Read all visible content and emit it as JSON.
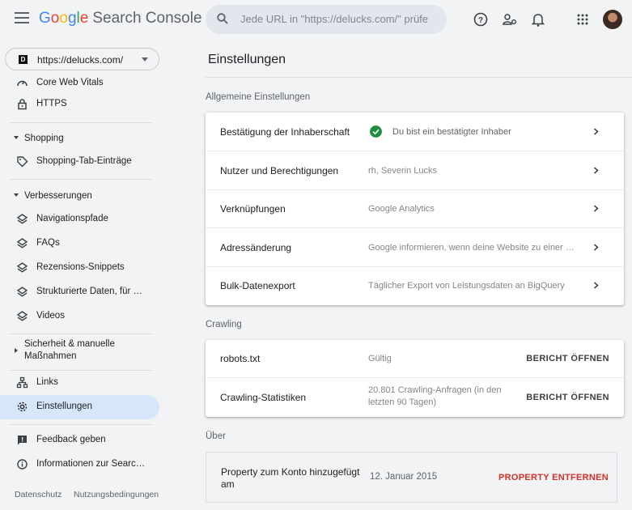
{
  "header": {
    "brand_google": "Google",
    "brand_product": "Search Console",
    "search_placeholder": "Jede URL in \"https://delucks.com/\" prüfe"
  },
  "sidebar": {
    "property_url": "https://delucks.com/",
    "property_favicon": "D",
    "items_top": [
      {
        "label": "Core Web Vitals",
        "icon": "gauge-icon"
      },
      {
        "label": "HTTPS",
        "icon": "lock-icon"
      }
    ],
    "shopping": {
      "heading": "Shopping",
      "items": [
        {
          "label": "Shopping-Tab-Einträge",
          "icon": "tag-icon"
        }
      ]
    },
    "enhancements": {
      "heading": "Verbesserungen",
      "items": [
        {
          "label": "Navigationspfade",
          "icon": "layers-icon"
        },
        {
          "label": "FAQs",
          "icon": "layers-icon"
        },
        {
          "label": "Rezensions-Snippets",
          "icon": "layers-icon"
        },
        {
          "label": "Strukturierte Daten, für …",
          "icon": "layers-icon"
        },
        {
          "label": "Videos",
          "icon": "layers-icon"
        }
      ]
    },
    "security": {
      "heading_line1": "Sicherheit & manuelle",
      "heading_line2": "Maßnahmen"
    },
    "links": {
      "label": "Links",
      "icon": "sitemap-icon"
    },
    "settings": {
      "label": "Einstellungen",
      "icon": "gear-icon"
    },
    "feedback": {
      "label": "Feedback geben",
      "icon": "feedback-icon"
    },
    "info": {
      "label": "Informationen zur Searc…",
      "icon": "info-icon"
    },
    "footer": {
      "privacy": "Datenschutz",
      "terms": "Nutzungsbedingungen"
    }
  },
  "main": {
    "title": "Einstellungen",
    "general": {
      "heading": "Allgemeine Einstellungen",
      "rows": [
        {
          "label": "Bestätigung der Inhaberschaft",
          "value": "Du bist ein bestätigter Inhaber"
        },
        {
          "label": "Nutzer und Berechtigungen",
          "value": "rh, Severin Lucks"
        },
        {
          "label": "Verknüpfungen",
          "value": "Google Analytics"
        },
        {
          "label": "Adressänderung",
          "value": "Google informieren, wenn deine Website zu einer neu…"
        },
        {
          "label": "Bulk-Datenexport",
          "value": "Täglicher Export von Leistungsdaten an BigQuery"
        }
      ]
    },
    "crawling": {
      "heading": "Crawling",
      "rows": [
        {
          "label": "robots.txt",
          "value": "Gültig",
          "action": "BERICHT ÖFFNEN"
        },
        {
          "label": "Crawling-Statistiken",
          "value_line1": "20.801 Crawling-Anfragen (in den",
          "value_line2": "letzten 90 Tagen)",
          "action": "BERICHT ÖFFNEN"
        }
      ]
    },
    "about": {
      "heading": "Über",
      "label_line1": "Property zum Konto hinzugefügt",
      "label_line2": "am",
      "value": "12. Januar 2015",
      "action": "PROPERTY ENTFERNEN"
    }
  },
  "colors": {
    "accent_blue": "#1a73e8",
    "active_nav": "#d6e6fb",
    "danger": "#d93025",
    "success": "#1e8e3e"
  }
}
